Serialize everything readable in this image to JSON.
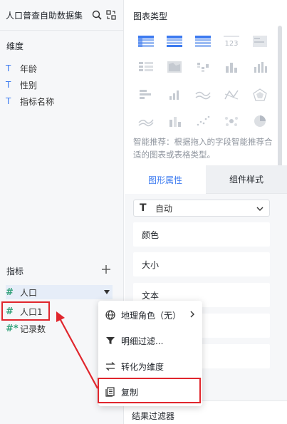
{
  "left_panel": {
    "dataset_title": "人口普查自助数据集",
    "dimension_label": "维度",
    "dimensions": [
      {
        "type_icon": "T",
        "name": "年龄"
      },
      {
        "type_icon": "T",
        "name": "性别"
      },
      {
        "type_icon": "T",
        "name": "指标名称"
      }
    ],
    "measure_label": "指标",
    "measures": [
      {
        "type_icon": "#",
        "name": "人口"
      },
      {
        "type_icon": "#",
        "name": "人口1"
      },
      {
        "type_icon": "#*",
        "name": "记录数"
      }
    ]
  },
  "right_panel": {
    "chart_type_title": "图表类型",
    "hint": "智能推荐：根据拖入的字段智能推荐合适的图表或表格类型。",
    "tabs": [
      "图形属性",
      "组件样式"
    ],
    "mark_type": {
      "icon": "T",
      "value": "自动"
    },
    "properties": [
      "颜色",
      "大小",
      "文本"
    ],
    "result_filter": "结果过滤器"
  },
  "context_menu": {
    "items": [
      {
        "icon": "globe-icon",
        "label": "地理角色（无）",
        "has_submenu": true
      },
      {
        "icon": "filter-icon",
        "label": "明细过滤..."
      },
      {
        "icon": "convert-icon",
        "label": "转化为维度"
      },
      {
        "icon": "copy-icon",
        "label": "复制"
      }
    ]
  },
  "colors": {
    "accent": "#3d7bf0",
    "measure_green": "#33a17a",
    "highlight_red": "#e0262d",
    "panel_bg": "#f6f7f9"
  }
}
